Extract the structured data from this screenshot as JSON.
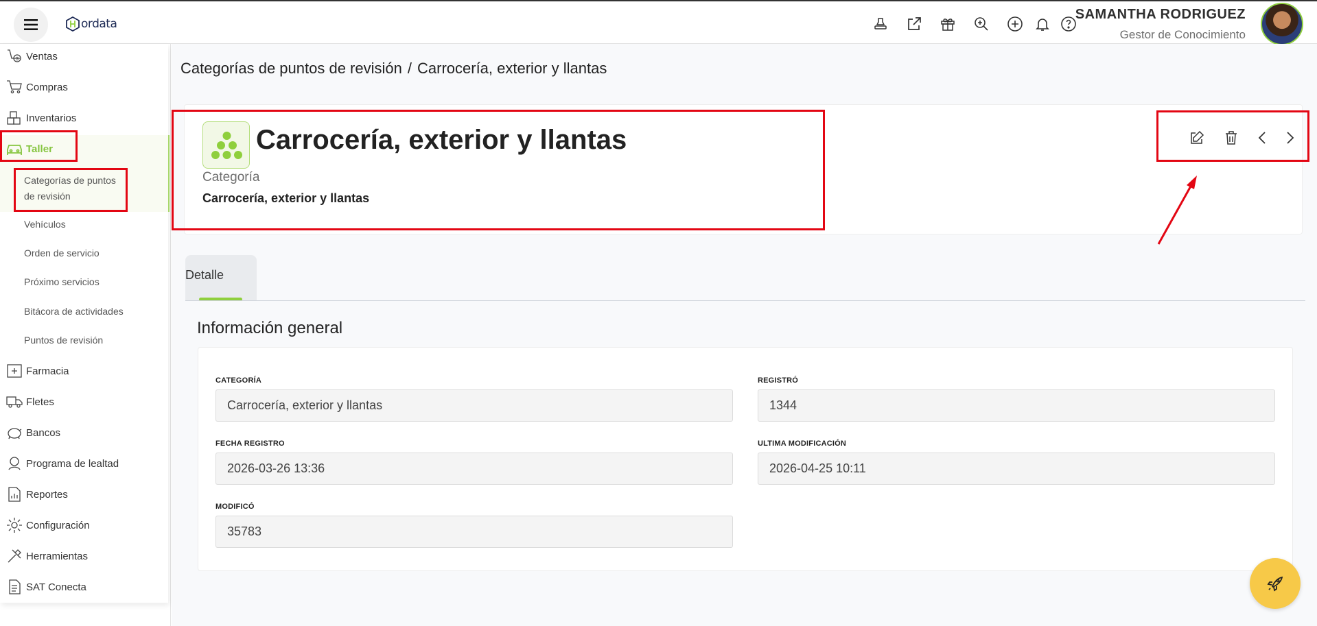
{
  "header": {
    "logo_text": "ordata",
    "user_name": "SAMANTHA RODRIGUEZ",
    "user_role": "Gestor de Conocimiento",
    "icons": [
      "stamp-icon",
      "external-link-icon",
      "gift-icon",
      "search-zoom-icon",
      "add-circle-icon",
      "bell-icon",
      "help-icon"
    ]
  },
  "sidebar": {
    "items": [
      {
        "label": "Ventas",
        "icon": "ventas-icon"
      },
      {
        "label": "Compras",
        "icon": "cart-icon"
      },
      {
        "label": "Inventarios",
        "icon": "boxes-icon"
      },
      {
        "label": "Taller",
        "icon": "car-icon",
        "active": true
      },
      {
        "label": "Farmacia",
        "icon": "pharmacy-icon"
      },
      {
        "label": "Fletes",
        "icon": "truck-icon"
      },
      {
        "label": "Bancos",
        "icon": "piggy-bank-icon"
      },
      {
        "label": "Programa de lealtad",
        "icon": "loyalty-icon"
      },
      {
        "label": "Reportes",
        "icon": "report-icon"
      },
      {
        "label": "Configuración",
        "icon": "gear-icon"
      },
      {
        "label": "Herramientas",
        "icon": "tools-icon"
      },
      {
        "label": "SAT Conecta",
        "icon": "document-icon"
      }
    ],
    "sub_items": [
      {
        "label_line1": "Categorías de puntos",
        "label_line2": "de revisión",
        "active": true
      },
      {
        "label": "Vehículos"
      },
      {
        "label": "Orden de servicio"
      },
      {
        "label": "Próximo servicios"
      },
      {
        "label": "Bitácora de actividades"
      },
      {
        "label": "Puntos de revisión"
      }
    ]
  },
  "breadcrumb": {
    "parent": "Categorías de puntos de revisión",
    "separator": "/",
    "current": "Carrocería, exterior y llantas"
  },
  "record": {
    "title": "Carrocería, exterior y llantas",
    "subtitle": "Categoría",
    "subvalue": "Carrocería, exterior y llantas",
    "actions": [
      "edit-icon",
      "trash-icon",
      "chevron-left-icon",
      "chevron-right-icon"
    ]
  },
  "tabs": [
    {
      "label": "Detalle",
      "active": true
    }
  ],
  "section": {
    "title": "Información general",
    "fields": {
      "categoria": {
        "label": "CATEGORÍA",
        "value": "Carrocería, exterior y llantas"
      },
      "registro": {
        "label": "REGISTRÓ",
        "value": "1344"
      },
      "fecha_registro": {
        "label": "FECHA REGISTRO",
        "value": "2026-03-26 13:36"
      },
      "ultima_mod": {
        "label": "ULTIMA MODIFICACIÓN",
        "value": "2026-04-25 10:11"
      },
      "modifico": {
        "label": "MODIFICÓ",
        "value": "35783"
      }
    }
  },
  "colors": {
    "accent": "#8fcf3d",
    "annotation": "#e30613",
    "fab": "#f7c948"
  }
}
